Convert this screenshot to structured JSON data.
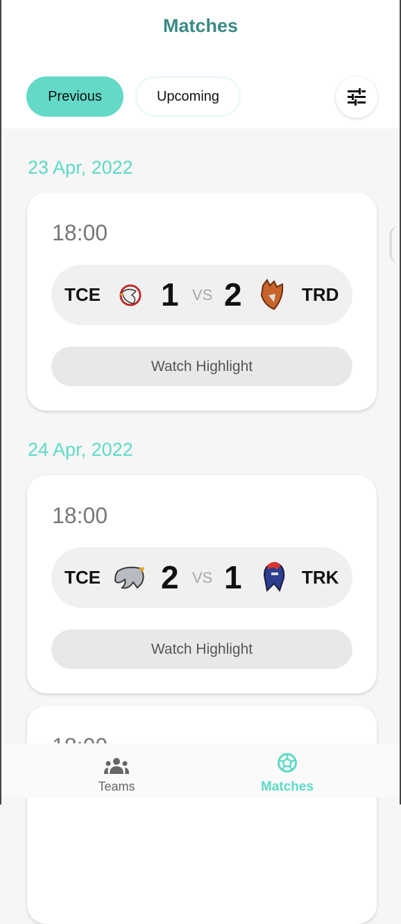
{
  "header": {
    "title": "Matches",
    "tabs": [
      {
        "label": "Previous",
        "active": true
      },
      {
        "label": "Upcoming",
        "active": false
      }
    ],
    "filter_icon": "tune-icon"
  },
  "accent": "#5dd9c6",
  "matches": [
    {
      "date": "23 Apr, 2022",
      "time": "18:00",
      "home": {
        "code": "TCE",
        "score": "1",
        "logo": "eagle-logo"
      },
      "vs": "VS",
      "away": {
        "code": "TRD",
        "score": "2",
        "logo": "dragon-logo"
      },
      "action": "Watch Highlight"
    },
    {
      "date": "24 Apr, 2022",
      "time": "18:00",
      "home": {
        "code": "TCE",
        "score": "2",
        "logo": "elephant-logo"
      },
      "vs": "VS",
      "away": {
        "code": "TRK",
        "score": "1",
        "logo": "spartan-logo"
      },
      "action": "Watch Highlight"
    },
    {
      "time": "18:00"
    }
  ],
  "nav": [
    {
      "label": "Teams",
      "icon": "groups-icon",
      "active": false
    },
    {
      "label": "Matches",
      "icon": "soccer-ball-icon",
      "active": true
    }
  ]
}
